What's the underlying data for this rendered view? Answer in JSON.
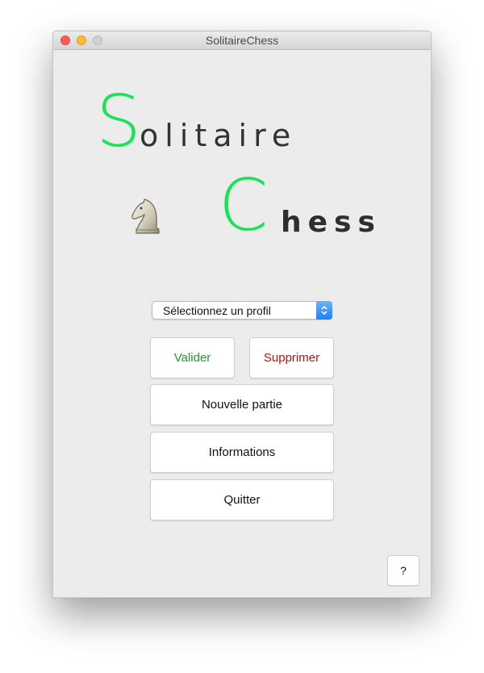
{
  "window": {
    "title": "SolitaireChess"
  },
  "logo": {
    "first_big": "S",
    "first_rest": "olitaire",
    "second_big": "C",
    "second_rest": "hess",
    "accent_color": "#19e356",
    "icon": "chess-knight-icon"
  },
  "profile_select": {
    "selected": "Sélectionnez un profil"
  },
  "buttons": {
    "valider": "Valider",
    "supprimer": "Supprimer",
    "nouvelle_partie": "Nouvelle partie",
    "informations": "Informations",
    "quitter": "Quitter",
    "help": "?"
  }
}
